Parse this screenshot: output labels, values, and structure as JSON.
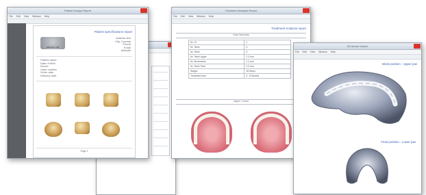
{
  "windows": {
    "report1": {
      "title": "Patient Design Report",
      "menu": [
        "File",
        "Edit",
        "View",
        "Window",
        "Help"
      ],
      "header_title": "Patient specifications report",
      "logo_text": "DENTAL LAB",
      "addr": [
        "Address line",
        "City, Country",
        "Phone",
        "Email",
        "Website"
      ],
      "patient_info": [
        "Patient name",
        "Date of birth",
        "Doctor",
        "Case number",
        "Order date",
        "Delivery date"
      ],
      "footer": "Page 1"
    },
    "report2": {
      "title": "Case Report"
    },
    "report3": {
      "title": "Treatment Analysis Report",
      "menu": [
        "File",
        "Edit",
        "View",
        "Window",
        "Help"
      ],
      "header_title": "Treatment Analysis report",
      "table_header": "Case Summary",
      "rows": [
        [
          "Nr. Of",
          "1"
        ],
        [
          "Nr. Teeth",
          "4"
        ],
        [
          "Nr. Teeth",
          "3"
        ],
        [
          "Nr. Teeth Upper",
          "2.3 mm"
        ],
        [
          "Nr. Movements",
          "1.4 mm"
        ],
        [
          "Nr. Teeth Total",
          "2.3 mm"
        ],
        [
          "Stages",
          "18 Steps"
        ],
        [
          "Treatment time",
          "6 - 8 Months"
        ]
      ],
      "section_label": "Upper / Lower"
    },
    "viewer": {
      "title": "3D Model Viewer",
      "menu": [
        "File",
        "Edit",
        "View",
        "Window",
        "Help"
      ],
      "upper_label": "Initial position - Upper jaw",
      "lower_label": "Final position - Lower jaw"
    }
  },
  "colors": {
    "accent_blue": "#3d63b5",
    "close_red": "#d9342b",
    "pdf_sidebar": "#5c5f63"
  }
}
